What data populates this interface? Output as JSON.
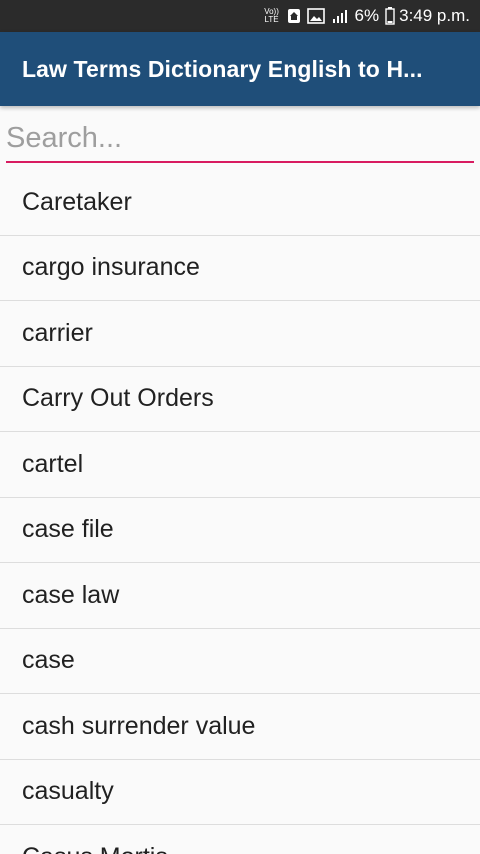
{
  "status_bar": {
    "volte": "VoLTE",
    "battery_percent": "6%",
    "time": "3:49 p.m."
  },
  "app_bar": {
    "title": "Law Terms Dictionary English to H..."
  },
  "search": {
    "placeholder": "Search...",
    "value": ""
  },
  "terms": [
    "Caretaker",
    "cargo insurance",
    "carrier",
    "Carry Out Orders",
    "cartel",
    "case file",
    "case law",
    "case",
    "cash surrender value",
    "casualty",
    "Casus Mortis"
  ],
  "colors": {
    "app_bar": "#1f4e79",
    "accent": "#d81b60",
    "status_bar": "#2b2b2b"
  }
}
